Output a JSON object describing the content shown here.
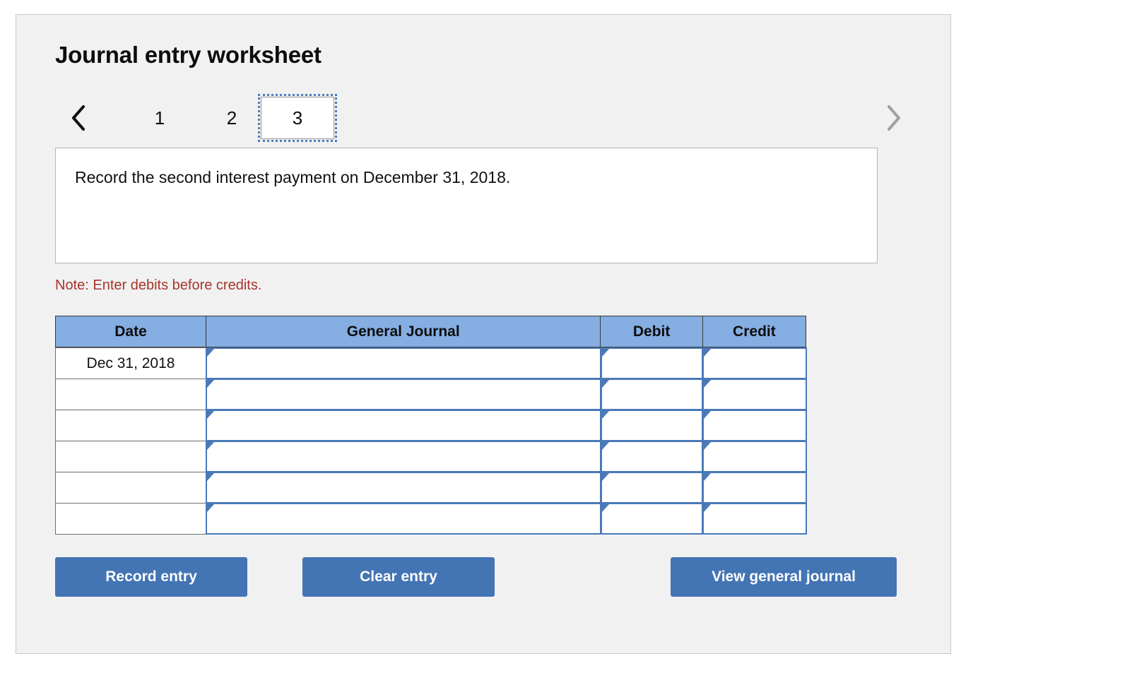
{
  "panel": {
    "title": "Journal entry worksheet"
  },
  "nav": {
    "prev_icon": "chevron-left-icon",
    "next_icon": "chevron-right-icon",
    "prev_enabled": true,
    "next_enabled": false,
    "tabs": [
      {
        "label": "1",
        "active": false
      },
      {
        "label": "2",
        "active": false
      },
      {
        "label": "3",
        "active": true
      }
    ],
    "active_tab": "3"
  },
  "prompt": {
    "text": "Record the second interest payment on December 31, 2018."
  },
  "note": {
    "text": "Note: Enter debits before credits."
  },
  "table": {
    "headers": {
      "date": "Date",
      "general_journal": "General Journal",
      "debit": "Debit",
      "credit": "Credit"
    },
    "rows": [
      {
        "date": "Dec 31, 2018",
        "general_journal": "",
        "debit": "",
        "credit": ""
      },
      {
        "date": "",
        "general_journal": "",
        "debit": "",
        "credit": ""
      },
      {
        "date": "",
        "general_journal": "",
        "debit": "",
        "credit": ""
      },
      {
        "date": "",
        "general_journal": "",
        "debit": "",
        "credit": ""
      },
      {
        "date": "",
        "general_journal": "",
        "debit": "",
        "credit": ""
      },
      {
        "date": "",
        "general_journal": "",
        "debit": "",
        "credit": ""
      }
    ]
  },
  "buttons": {
    "record": "Record entry",
    "clear": "Clear entry",
    "view": "View general journal"
  },
  "colors": {
    "header_blue": "#85aee2",
    "button_blue": "#4374b3",
    "field_border_blue": "#4a79b8",
    "note_red": "#a8342a",
    "panel_bg": "#f1f1f1",
    "focus_outline_blue": "#4a7ebb"
  }
}
